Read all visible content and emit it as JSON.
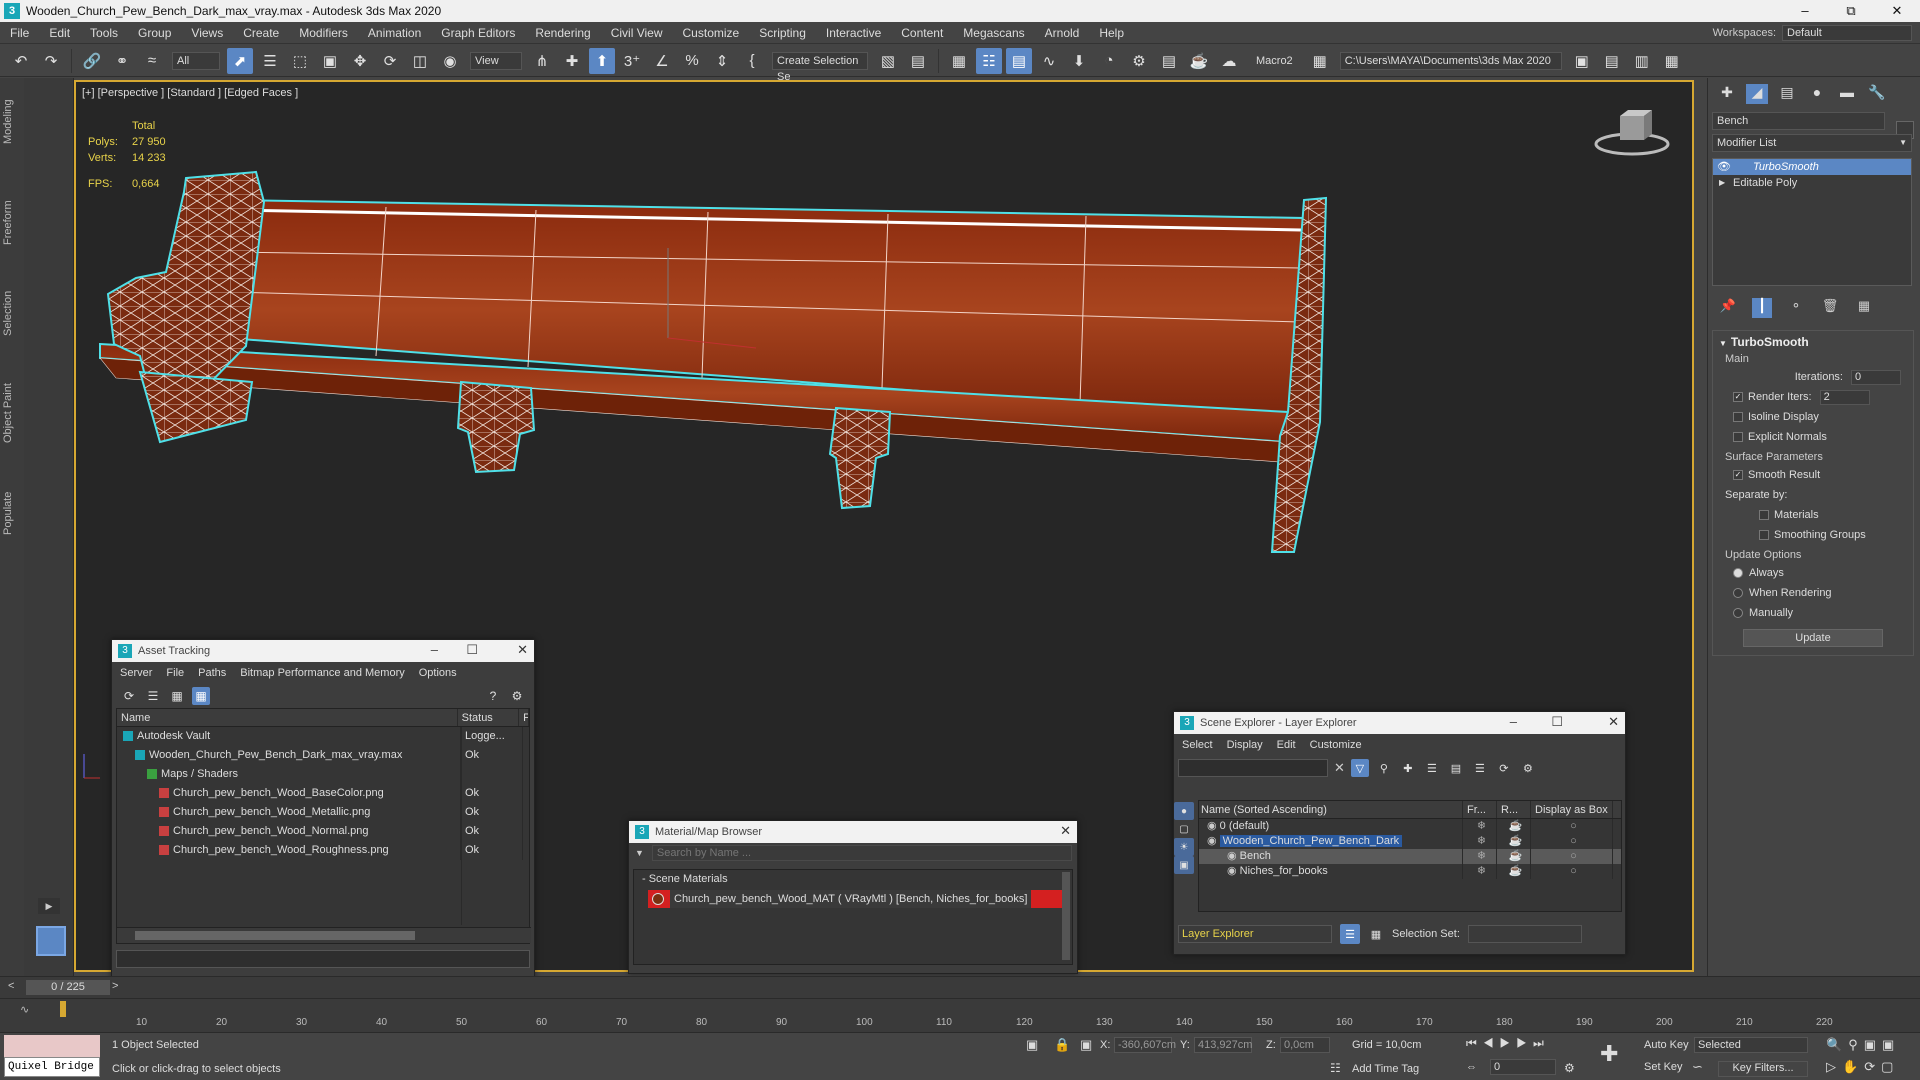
{
  "window": {
    "title": "Wooden_Church_Pew_Bench_Dark_max_vray.max - Autodesk 3ds Max 2020"
  },
  "menu": [
    "File",
    "Edit",
    "Tools",
    "Group",
    "Views",
    "Create",
    "Modifiers",
    "Animation",
    "Graph Editors",
    "Rendering",
    "Civil View",
    "Customize",
    "Scripting",
    "Interactive",
    "Content",
    "Megascans",
    "Arnold",
    "Help"
  ],
  "workspaces": {
    "label": "Workspaces:",
    "value": "Default"
  },
  "toolbar": {
    "filter_value": "All",
    "view_value": "View",
    "create_selection_set": "Create Selection Se",
    "macro_label": "Macro2",
    "path_value": "C:\\Users\\MAYA\\Documents\\3ds Max 2020"
  },
  "left_tabs": [
    "Modeling",
    "Freeform",
    "Selection",
    "Object Paint",
    "Populate"
  ],
  "viewport": {
    "label": "[+] [Perspective ] [Standard ] [Edged Faces ]",
    "stats": {
      "header": "Total",
      "polys_label": "Polys:",
      "polys": "27 950",
      "verts_label": "Verts:",
      "verts": "14 233",
      "fps_label": "FPS:",
      "fps": "0,664"
    }
  },
  "command_panel": {
    "object_name": "Bench",
    "modifier_list": "Modifier List",
    "stack": [
      "TurboSmooth",
      "Editable Poly"
    ],
    "turbosmooth": {
      "title": "TurboSmooth",
      "main": "Main",
      "iterations_label": "Iterations:",
      "iterations": "0",
      "render_iters_label": "Render Iters:",
      "render_iters": "2",
      "isoline": "Isoline Display",
      "explicit_normals": "Explicit Normals",
      "surface_params": "Surface Parameters",
      "smooth_result": "Smooth Result",
      "separate_by": "Separate by:",
      "materials": "Materials",
      "smoothing_groups": "Smoothing Groups",
      "update_options": "Update Options",
      "always": "Always",
      "when_rendering": "When Rendering",
      "manually": "Manually",
      "update_btn": "Update"
    }
  },
  "asset_tracking": {
    "title": "Asset Tracking",
    "menu": [
      "Server",
      "File",
      "Paths",
      "Bitmap Performance and Memory",
      "Options"
    ],
    "columns": [
      "Name",
      "Status",
      "P"
    ],
    "rows": [
      {
        "name": "Autodesk Vault",
        "status": "Logge...",
        "indent": 0
      },
      {
        "name": "Wooden_Church_Pew_Bench_Dark_max_vray.max",
        "status": "Ok",
        "indent": 1
      },
      {
        "name": "Maps / Shaders",
        "status": "",
        "indent": 2
      },
      {
        "name": "Church_pew_bench_Wood_BaseColor.png",
        "status": "Ok",
        "indent": 3
      },
      {
        "name": "Church_pew_bench_Wood_Metallic.png",
        "status": "Ok",
        "indent": 3
      },
      {
        "name": "Church_pew_bench_Wood_Normal.png",
        "status": "Ok",
        "indent": 3
      },
      {
        "name": "Church_pew_bench_Wood_Roughness.png",
        "status": "Ok",
        "indent": 3
      }
    ]
  },
  "material_browser": {
    "title": "Material/Map Browser",
    "search_placeholder": "Search by Name ...",
    "section": "- Scene Materials",
    "material": "Church_pew_bench_Wood_MAT ( VRayMtl ) [Bench, Niches_for_books]"
  },
  "scene_explorer": {
    "title": "Scene Explorer - Layer Explorer",
    "menu": [
      "Select",
      "Display",
      "Edit",
      "Customize"
    ],
    "columns": [
      "Name (Sorted Ascending)",
      "Fr...",
      "R...",
      "Display as Box"
    ],
    "rows": [
      {
        "name": "0 (default)",
        "indent": 0
      },
      {
        "name": "Wooden_Church_Pew_Bench_Dark",
        "indent": 0
      },
      {
        "name": "Bench",
        "indent": 1
      },
      {
        "name": "Niches_for_books",
        "indent": 1
      }
    ],
    "layer_explorer": "Layer Explorer",
    "selection_set_label": "Selection Set:"
  },
  "timeline": {
    "frame": "0 / 225",
    "ticks": [
      "10",
      "20",
      "30",
      "40",
      "50",
      "60",
      "70",
      "80",
      "90",
      "100",
      "110",
      "120",
      "130",
      "140",
      "150",
      "160",
      "170",
      "180",
      "190",
      "200",
      "210",
      "220"
    ]
  },
  "status": {
    "quixel": "Quixel Bridge",
    "objects_selected": "1 Object Selected",
    "prompt": "Click or click-drag to select objects",
    "x_label": "X:",
    "x": "-360,607cm",
    "y_label": "Y:",
    "y": "413,927cm",
    "z_label": "Z:",
    "z": "0,0cm",
    "grid": "Grid = 10,0cm",
    "add_time_tag": "Add Time Tag",
    "auto_key": "Auto Key",
    "selected": "Selected",
    "set_key": "Set Key",
    "key_filters": "Key Filters...",
    "frame_field": "0"
  },
  "colors": {
    "accent": "#5b87c4",
    "viewport_border": "#d6a832",
    "stats": "#e8d34a",
    "selection_outline": "#4fe0e8",
    "material_swatch": "#d42020"
  }
}
